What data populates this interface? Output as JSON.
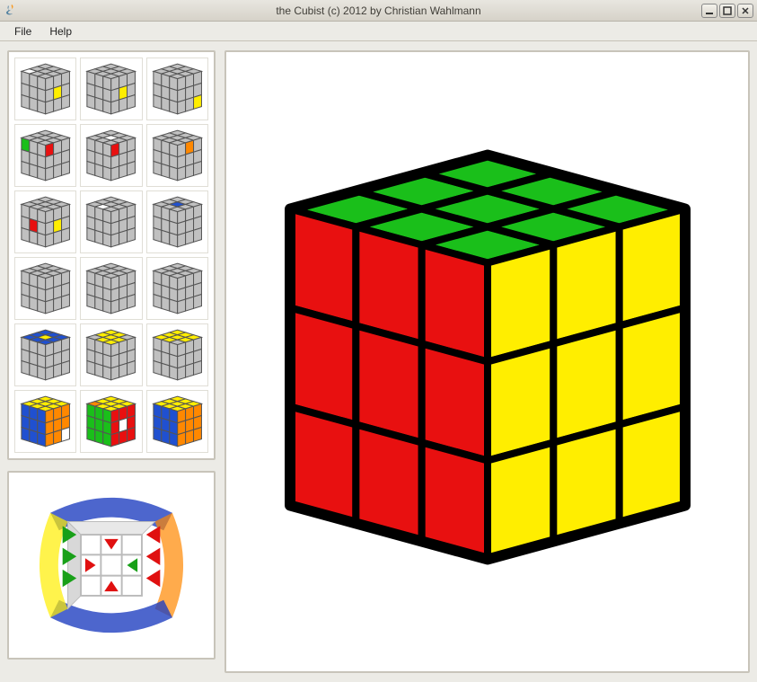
{
  "window": {
    "title": "the Cubist (c) 2012 by Christian Wahlmann"
  },
  "menu": {
    "file": "File",
    "help": "Help"
  },
  "thumbnails": {
    "count": 18,
    "rows": 6,
    "cols": 3
  },
  "cube": {
    "top_color": "#1abf1a",
    "front_color": "#ffee00",
    "left_color": "#e81010",
    "line_color": "#000000"
  },
  "orient_cube": {
    "top_color": "#2040c0",
    "front_color": "#e01010",
    "left_color": "#18a018",
    "frame_color": "#bbbbbb"
  },
  "thumb_palette": {
    "grey": "#c0c0c0",
    "yellow": "#ffee00",
    "green": "#1abf1a",
    "blue": "#2050d0",
    "red": "#e81010",
    "white": "#ffffff",
    "orange": "#ff8800"
  }
}
